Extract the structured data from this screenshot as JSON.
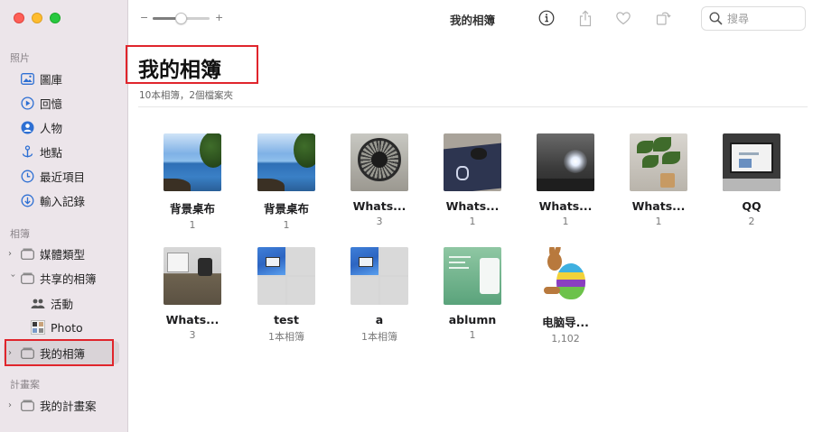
{
  "window": {
    "title": "我的相簿"
  },
  "sidebar": {
    "sections": [
      {
        "label": "照片"
      },
      {
        "label": "相簿"
      },
      {
        "label": "計畫案"
      }
    ],
    "photos_items": [
      {
        "label": "圖庫",
        "icon": "library-icon"
      },
      {
        "label": "回憶",
        "icon": "memories-icon"
      },
      {
        "label": "人物",
        "icon": "people-icon"
      },
      {
        "label": "地點",
        "icon": "places-icon"
      },
      {
        "label": "最近項目",
        "icon": "recents-icon"
      },
      {
        "label": "輸入記錄",
        "icon": "imports-icon"
      }
    ],
    "albums_items": [
      {
        "label": "媒體類型",
        "icon": "folder-icon"
      },
      {
        "label": "共享的相簿",
        "icon": "folder-icon"
      },
      {
        "label": "活動",
        "icon": "activity-icon"
      },
      {
        "label": "Photo",
        "icon": "photo-thumb-icon"
      },
      {
        "label": "我的相簿",
        "icon": "folder-icon"
      }
    ],
    "projects_items": [
      {
        "label": "我的計畫案",
        "icon": "folder-icon"
      }
    ]
  },
  "toolbar": {
    "zoom_minus": "−",
    "zoom_plus": "+",
    "zoom_level": 0.5,
    "title": "我的相簿",
    "search_placeholder": "搜尋"
  },
  "main": {
    "title": "我的相簿",
    "subtitle": "10本相簿，2個檔案夾",
    "albums": [
      {
        "name": "背景桌布",
        "count": "1",
        "thumb": "sea"
      },
      {
        "name": "背景桌布",
        "count": "1",
        "thumb": "sea"
      },
      {
        "name": "Whats...",
        "count": "3",
        "thumb": "fan"
      },
      {
        "name": "Whats...",
        "count": "1",
        "thumb": "mouse"
      },
      {
        "name": "Whats...",
        "count": "1",
        "thumb": "light"
      },
      {
        "name": "Whats...",
        "count": "1",
        "thumb": "plant"
      },
      {
        "name": "QQ",
        "count": "2",
        "thumb": "qq"
      },
      {
        "name": "Whats...",
        "count": "3",
        "thumb": "room"
      },
      {
        "name": "test",
        "count": "1本相簿",
        "thumb": "grid"
      },
      {
        "name": "a",
        "count": "1本相簿",
        "thumb": "grid"
      },
      {
        "name": "ablumn",
        "count": "1",
        "thumb": "green"
      },
      {
        "name": "电脑导...",
        "count": "1,102",
        "thumb": "egg"
      }
    ]
  },
  "colors": {
    "highlight_box": "#e0252c",
    "sidebar_bg": "#ece5ea",
    "accent_blue": "#2d6fd3"
  }
}
